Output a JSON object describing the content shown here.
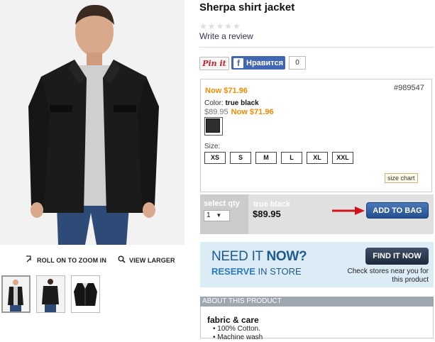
{
  "product": {
    "title": "Sherpa shirt jacket",
    "write_review": "Write a review",
    "rating_stars": "★★★★★"
  },
  "gallery": {
    "roll_zoom": "ROLL ON TO ZOOM IN",
    "view_larger": "VIEW LARGER"
  },
  "social": {
    "pinit": "Pin it",
    "fb_like": "Нравится",
    "fb_count": "0"
  },
  "pricing": {
    "now_price": "Now $71.96",
    "sku": "#989547",
    "color_label": "Color:",
    "color_value": "true black",
    "was_price": "$89.95",
    "now_price_inline": "Now $71.96",
    "swatch_color": "#2e2e2e"
  },
  "sizes": {
    "label": "Size:",
    "options": [
      "XS",
      "S",
      "M",
      "L",
      "XL",
      "XXL"
    ],
    "size_chart": "size chart"
  },
  "bag": {
    "qty_label": "select qty",
    "qty_value": "1",
    "color": "true black",
    "price": "$89.95",
    "add_to_bag": "ADD TO BAG"
  },
  "store": {
    "need_it": "NEED IT",
    "now": "NOW?",
    "reserve": "RESERVE",
    "in_store": "IN STORE",
    "find_button": "FIND IT NOW",
    "check_text": "Check stores near you for this product"
  },
  "about": {
    "header": "ABOUT THIS PRODUCT",
    "section_title": "fabric & care",
    "bullets": [
      "100% Cotton.",
      "Machine wash"
    ]
  },
  "colors": {
    "accent_orange": "#f28c00",
    "button_blue": "#2f5f9f",
    "arrow_red": "#d0131b",
    "banner_bg": "#dcecf7"
  }
}
